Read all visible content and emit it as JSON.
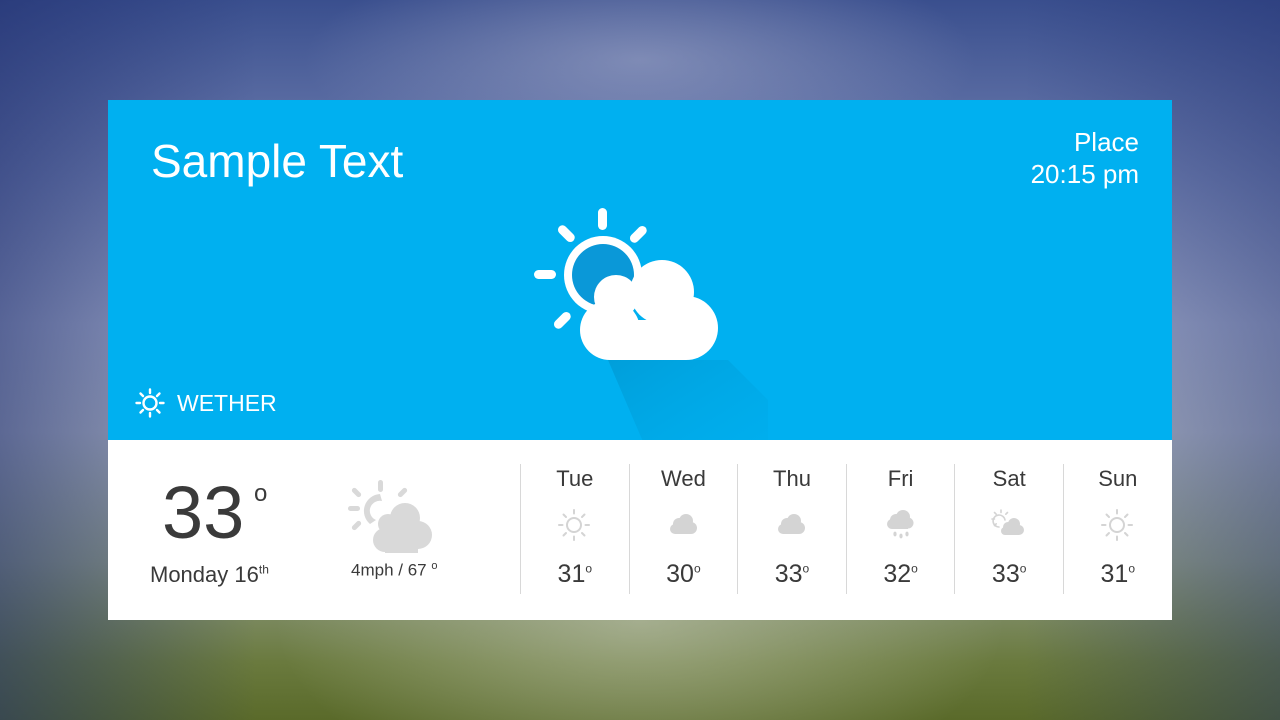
{
  "hero": {
    "title": "Sample Text",
    "place": "Place",
    "time": "20:15 pm",
    "main_icon": "sun-behind-cloud-icon",
    "brand_icon": "sun-icon",
    "brand_label": "WETHER",
    "background_color": "#00b0f0"
  },
  "current": {
    "temperature": "33",
    "degree_symbol": "o",
    "day": "Monday 16",
    "day_suffix": "th",
    "icon": "partly-cloudy-icon",
    "wind": "4mph / 67",
    "wind_degree_symbol": "o"
  },
  "forecast": [
    {
      "day": "Tue",
      "icon": "sun-icon",
      "temp": "31",
      "deg": "o"
    },
    {
      "day": "Wed",
      "icon": "cloud-icon",
      "temp": "30",
      "deg": "o"
    },
    {
      "day": "Thu",
      "icon": "cloud-icon",
      "temp": "33",
      "deg": "o"
    },
    {
      "day": "Fri",
      "icon": "rain-cloud-icon",
      "temp": "32",
      "deg": "o"
    },
    {
      "day": "Sat",
      "icon": "partly-cloudy-icon",
      "temp": "33",
      "deg": "o"
    },
    {
      "day": "Sun",
      "icon": "sun-icon",
      "temp": "31",
      "deg": "o"
    }
  ]
}
